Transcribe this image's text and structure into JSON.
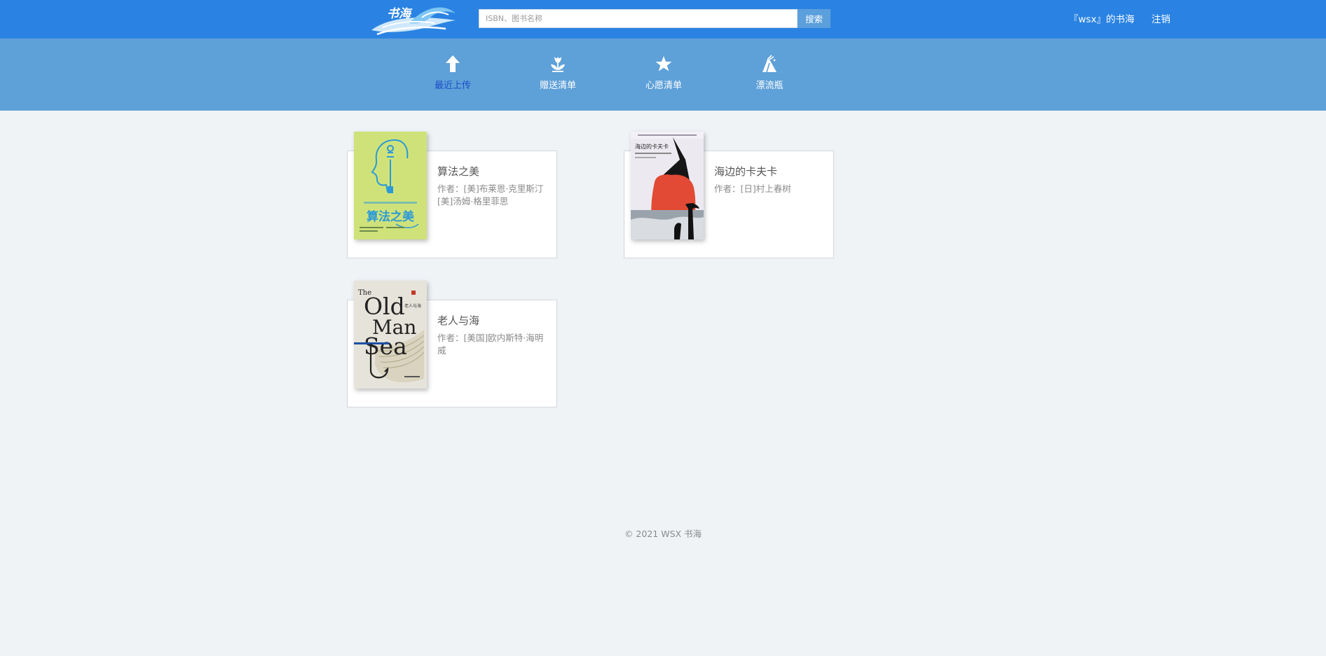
{
  "header": {
    "logo_alt": "书海",
    "search_placeholder": "ISBN、图书名称",
    "search_button": "搜索",
    "user_link": "『wsx』的书海",
    "logout": "注销"
  },
  "nav": {
    "items": [
      {
        "label": "最近上传",
        "icon": "arrow-up-icon",
        "active": true
      },
      {
        "label": "赠送清单",
        "icon": "flower-icon",
        "active": false
      },
      {
        "label": "心愿清单",
        "icon": "star-icon",
        "active": false
      },
      {
        "label": "漂流瓶",
        "icon": "bottle-icon",
        "active": false
      }
    ]
  },
  "books": [
    {
      "title": "算法之美",
      "author": "作者：[美]布莱恩·克里斯汀[美]汤姆·格里菲思",
      "cover_text": "算法之美"
    },
    {
      "title": "海边的卡夫卡",
      "author": "作者：[日]村上春树",
      "cover_text": "海边的卡夫卡"
    },
    {
      "title": "老人与海",
      "author": "作者：[美国]欧内斯特·海明威",
      "cover_text": [
        "The",
        "Old",
        "Man",
        "Sea",
        "老人与海"
      ]
    }
  ],
  "footer": {
    "copyright": "© 2021 WSX 书海"
  }
}
